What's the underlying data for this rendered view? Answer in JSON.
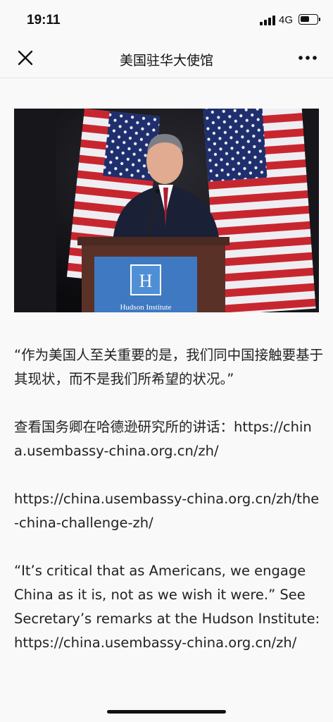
{
  "status_bar": {
    "time": "19:11",
    "network": "4G",
    "battery_level": 0.55
  },
  "nav": {
    "title": "美国驻华大使馆",
    "close_icon": "close-icon",
    "more_icon": "more-icon"
  },
  "hero": {
    "podium_logo_letter": "H",
    "podium_text": "Hudson Institute"
  },
  "article": {
    "quote_zh": "“作为美国人至关重要的是，我们同中国接触要基于其现状，而不是我们所希望的状况。”",
    "remarks_zh_prefix": "查看国务卿在哈德逊研究所的讲话：",
    "remarks_zh_link": "https://china.usembassy-china.org.cn/zh/",
    "challenge_link": "https://china.usembassy-china.org.cn/zh/the-china-challenge-zh/",
    "quote_en": "“It’s critical that as Americans, we engage China as it is, not as we wish it were.” See Secretary’s remarks at the Hudson Institute:",
    "remarks_en_link": "https://china.usembassy-china.org.cn/zh/"
  },
  "colors": {
    "background": "#f9f9f9",
    "text": "#222222",
    "podium_sign": "#3f79c2"
  }
}
